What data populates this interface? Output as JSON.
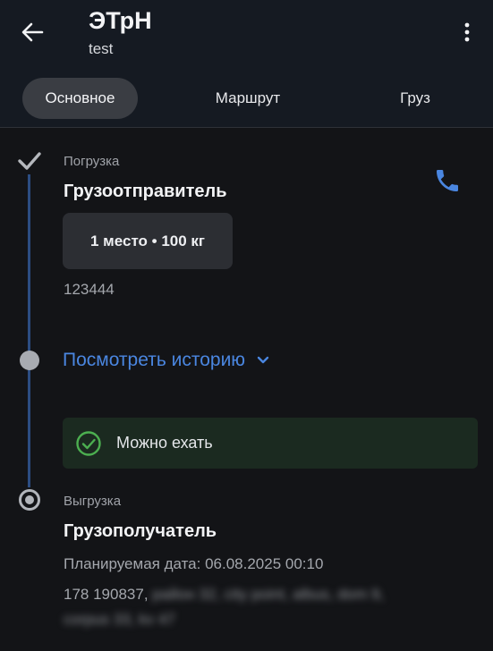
{
  "header": {
    "title": "ЭТрН",
    "subtitle": "test",
    "back_icon": "arrow-left-icon",
    "menu_icon": "more-vert-icon"
  },
  "tabs": [
    {
      "label": "Основное",
      "active": true
    },
    {
      "label": "Маршрут",
      "active": false
    },
    {
      "label": "Груз",
      "active": false
    }
  ],
  "loading": {
    "caption": "Погрузка",
    "title": "Грузоотправитель",
    "cargo_chip": "1 место • 100 кг",
    "code": "123444",
    "phone_icon": "phone-icon",
    "status_icon": "checkmark-icon"
  },
  "history": {
    "label": "Посмотреть историю",
    "icon": "chevron-down-icon"
  },
  "status": {
    "label": "Можно ехать",
    "icon": "check-circle-icon"
  },
  "unloading": {
    "caption": "Выгрузка",
    "title": "Грузополучатель",
    "planned_date": "Планируемая дата: 06.08.2025 00:10",
    "address_visible": "178 190837,",
    "address_blurred_1": "район 32, city point, albus, dom 9,",
    "address_blurred_2": "corpus 33, kv 47"
  },
  "colors": {
    "accent": "#4a86e0",
    "timeline": "#2c4d82",
    "success": "#4caf50",
    "background": "#131417"
  }
}
